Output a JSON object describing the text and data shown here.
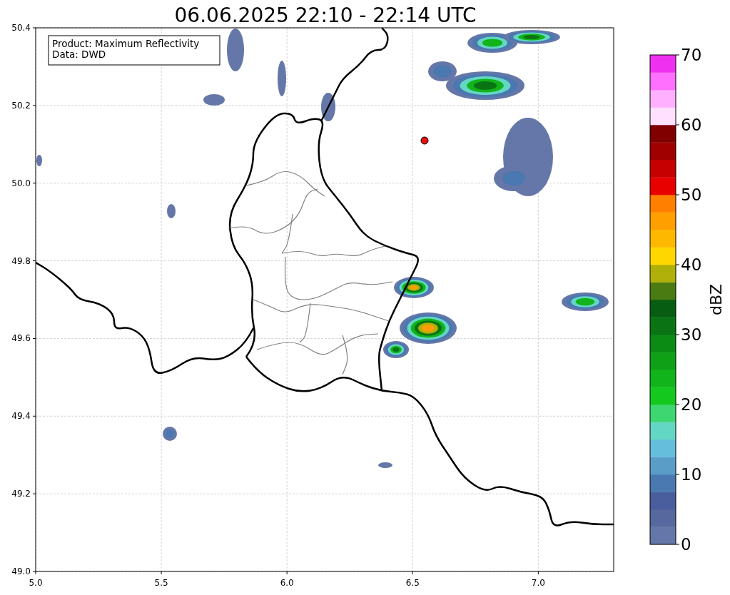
{
  "title": "06.06.2025 22:10 - 22:14 UTC",
  "info_box": [
    "Product: Maximum Reflectivity",
    "Data: DWD"
  ],
  "map": {
    "xticks": [
      "5.0",
      "5.5",
      "6.0",
      "6.5",
      "7.0"
    ],
    "yticks": [
      "50.4",
      "50.2",
      "50.0",
      "49.8",
      "49.6",
      "49.4",
      "49.2",
      "49.0"
    ]
  },
  "colorbar": {
    "label": "dBZ",
    "ticks": [
      "70",
      "60",
      "50",
      "40",
      "30",
      "20",
      "10",
      "0"
    ],
    "bins": [
      {
        "color": "#6577a8"
      },
      {
        "color": "#56689e"
      },
      {
        "color": "#4a5e9e"
      },
      {
        "color": "#4a78b0"
      },
      {
        "color": "#5a9ec8"
      },
      {
        "color": "#65bedc"
      },
      {
        "color": "#64d6c4"
      },
      {
        "color": "#3dd670"
      },
      {
        "color": "#14c81e"
      },
      {
        "color": "#11b41a"
      },
      {
        "color": "#0fa018"
      },
      {
        "color": "#0b8a14"
      },
      {
        "color": "#0a7414"
      },
      {
        "color": "#075e12"
      },
      {
        "color": "#4a7a12"
      },
      {
        "color": "#b0b00a"
      },
      {
        "color": "#ffd700"
      },
      {
        "color": "#ffb800"
      },
      {
        "color": "#ff9f00"
      },
      {
        "color": "#ff7f00"
      },
      {
        "color": "#e80000"
      },
      {
        "color": "#c60000"
      },
      {
        "color": "#a00000"
      },
      {
        "color": "#800000"
      },
      {
        "color": "#ffe0ff"
      },
      {
        "color": "#ffb0ff"
      },
      {
        "color": "#ff70ff"
      },
      {
        "color": "#f030f0"
      }
    ]
  }
}
